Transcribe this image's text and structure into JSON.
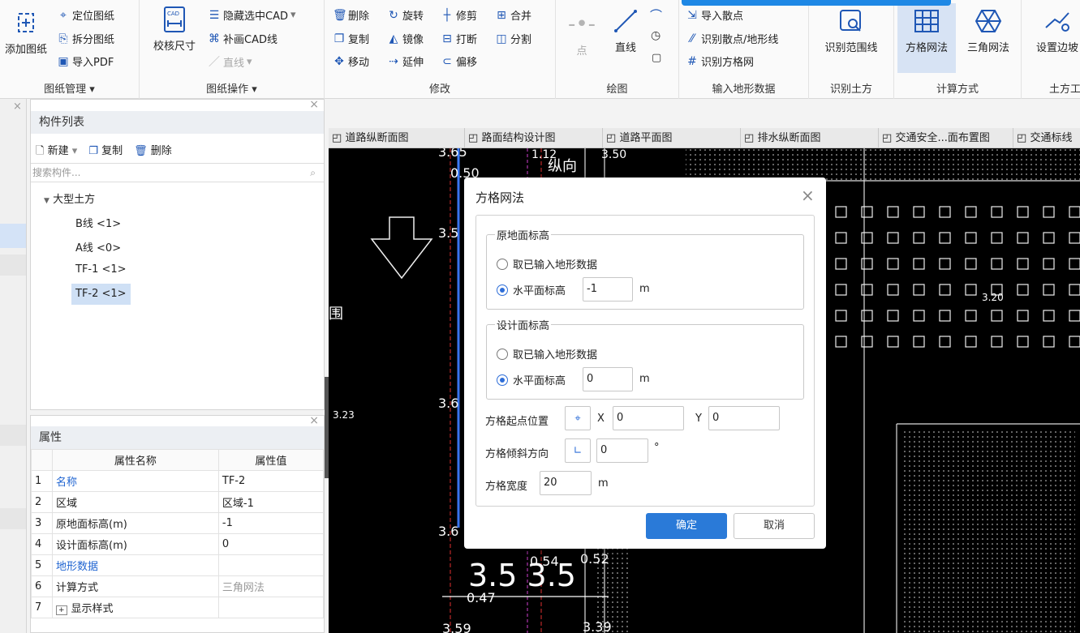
{
  "ribbon": {
    "g1": {
      "label": "图纸管理",
      "add": "添加图纸",
      "locate": "定位图纸",
      "split": "拆分图纸",
      "import_pdf": "导入PDF"
    },
    "g2": {
      "label": "图纸操作",
      "check": "校核尺寸",
      "hide": "隐藏选中CAD",
      "redraw": "补画CAD线",
      "line": "直线"
    },
    "g3": {
      "label": "修改",
      "delete": "删除",
      "rotate": "旋转",
      "trim": "修剪",
      "merge": "合并",
      "copy": "复制",
      "mirror": "镜像",
      "break": "打断",
      "divide": "分割",
      "move": "移动",
      "extend": "延伸",
      "offset": "偏移"
    },
    "g4": {
      "label": "绘图",
      "point": "点",
      "line": "直线"
    },
    "g5": {
      "label": "输入地形数据",
      "import_points": "导入散点",
      "recog_points": "识别散点/地形线",
      "recog_grid": "识别方格网"
    },
    "g6": {
      "label": "识别土方",
      "recog_range": "识别范围线"
    },
    "g7": {
      "label": "计算方式",
      "grid": "方格网法",
      "tri": "三角网法"
    },
    "g8": {
      "label": "土方工",
      "set_slope": "设置边坡"
    }
  },
  "components": {
    "title": "构件列表",
    "new": "新建",
    "copy": "复制",
    "delete": "删除",
    "search_placeholder": "搜索构件...",
    "root": "大型土方",
    "items": [
      "B线 <1>",
      "A线 <0>",
      "TF-1 <1>",
      "TF-2 <1>"
    ]
  },
  "properties": {
    "title": "属性",
    "col_name": "属性名称",
    "col_value": "属性值",
    "rows": [
      {
        "n": "1",
        "k": "名称",
        "v": "TF-2"
      },
      {
        "n": "2",
        "k": "区域",
        "v": "区域-1"
      },
      {
        "n": "3",
        "k": "原地面标高(m)",
        "v": "-1"
      },
      {
        "n": "4",
        "k": "设计面标高(m)",
        "v": "0"
      },
      {
        "n": "5",
        "k": "地形数据",
        "v": ""
      },
      {
        "n": "6",
        "k": "计算方式",
        "v": "三角网法"
      },
      {
        "n": "7",
        "k": "显示样式",
        "v": ""
      }
    ]
  },
  "tabs": [
    "道路纵断面图",
    "路面结构设计图",
    "道路平面图",
    "排水纵断面图",
    "交通安全...面布置图",
    "交通标线"
  ],
  "dialog": {
    "title": "方格网法",
    "orig": {
      "legend": "原地面标高",
      "opt1": "取已输入地形数据",
      "opt2": "水平面标高",
      "value": "-1",
      "unit": "m"
    },
    "design": {
      "legend": "设计面标高",
      "opt1": "取已输入地形数据",
      "opt2": "水平面标高",
      "value": "0",
      "unit": "m"
    },
    "origin_label": "方格起点位置",
    "x_label": "X",
    "x": "0",
    "y_label": "Y",
    "y": "0",
    "tilt_label": "方格倾斜方向",
    "tilt": "0",
    "tilt_unit": "°",
    "width_label": "方格宽度",
    "width": "20",
    "width_unit": "m",
    "ok": "确定",
    "cancel": "取消"
  },
  "canvas_text": {
    "t1": "3.65",
    "t2": "1.12",
    "t3": "3.50",
    "t4": "0.50",
    "t5": "3.5",
    "t6": "3.20",
    "t7": "3.23",
    "t8": "3.6",
    "t9": "0.54",
    "t10": "0.52",
    "t11": "0.47",
    "t12": "3.59",
    "t13": "3.39",
    "t14": "纵向",
    "t15": "围",
    "t16": "3.5  3.5"
  }
}
